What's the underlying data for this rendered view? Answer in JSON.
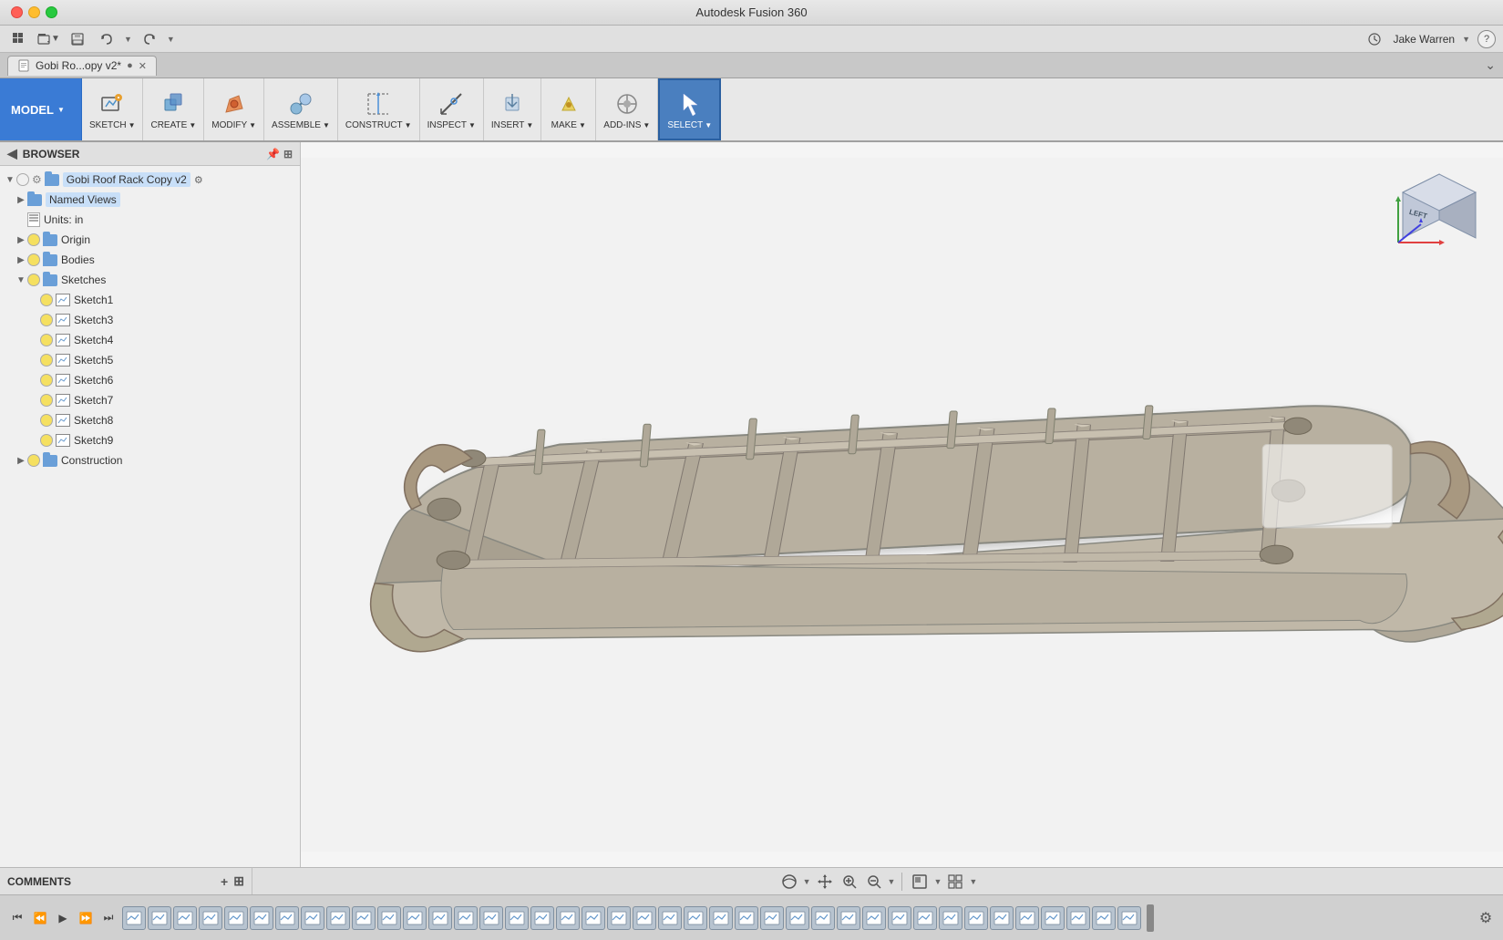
{
  "app": {
    "title": "Autodesk Fusion 360"
  },
  "titlebar": {
    "title": "Autodesk Fusion 360"
  },
  "tab": {
    "label": "Gobi Ro...opy v2*",
    "modified": true
  },
  "ribbon": {
    "model_label": "MODEL",
    "groups": [
      {
        "id": "sketch",
        "label": "SKETCH",
        "has_dropdown": true
      },
      {
        "id": "create",
        "label": "CREATE",
        "has_dropdown": true
      },
      {
        "id": "modify",
        "label": "MODIFY",
        "has_dropdown": true
      },
      {
        "id": "assemble",
        "label": "ASSEMBLE",
        "has_dropdown": true
      },
      {
        "id": "construct",
        "label": "CONSTRUCT",
        "has_dropdown": true
      },
      {
        "id": "inspect",
        "label": "INSPECT",
        "has_dropdown": true
      },
      {
        "id": "insert",
        "label": "INSERT",
        "has_dropdown": true
      },
      {
        "id": "make",
        "label": "MAKE",
        "has_dropdown": true
      },
      {
        "id": "add_ins",
        "label": "ADD-INS",
        "has_dropdown": true
      },
      {
        "id": "select",
        "label": "SELECT",
        "has_dropdown": true,
        "active": true
      }
    ]
  },
  "browser": {
    "title": "BROWSER",
    "root_label": "Gobi Roof Rack Copy v2",
    "items": [
      {
        "id": "named-views",
        "label": "Named Views",
        "indent": 1,
        "expandable": true,
        "expanded": false
      },
      {
        "id": "units",
        "label": "Units: in",
        "indent": 1,
        "expandable": false
      },
      {
        "id": "origin",
        "label": "Origin",
        "indent": 1,
        "expandable": true,
        "expanded": false
      },
      {
        "id": "bodies",
        "label": "Bodies",
        "indent": 1,
        "expandable": true,
        "expanded": false
      },
      {
        "id": "sketches",
        "label": "Sketches",
        "indent": 1,
        "expandable": true,
        "expanded": true
      },
      {
        "id": "sketch1",
        "label": "Sketch1",
        "indent": 2,
        "expandable": false
      },
      {
        "id": "sketch3",
        "label": "Sketch3",
        "indent": 2,
        "expandable": false
      },
      {
        "id": "sketch4",
        "label": "Sketch4",
        "indent": 2,
        "expandable": false
      },
      {
        "id": "sketch5",
        "label": "Sketch5",
        "indent": 2,
        "expandable": false
      },
      {
        "id": "sketch6",
        "label": "Sketch6",
        "indent": 2,
        "expandable": false
      },
      {
        "id": "sketch7",
        "label": "Sketch7",
        "indent": 2,
        "expandable": false
      },
      {
        "id": "sketch8",
        "label": "Sketch8",
        "indent": 2,
        "expandable": false
      },
      {
        "id": "sketch9",
        "label": "Sketch9",
        "indent": 2,
        "expandable": false
      },
      {
        "id": "construction",
        "label": "Construction",
        "indent": 1,
        "expandable": true,
        "expanded": false
      }
    ]
  },
  "comments": {
    "label": "COMMENTS"
  },
  "viewport": {
    "background_color": "#f0f0f0"
  },
  "navcube": {
    "label": "LEFT"
  },
  "statusbar": {
    "view_controls": [
      "orbit",
      "pan",
      "zoom-in",
      "zoom-out",
      "zoom-fit",
      "display-settings",
      "display-mode",
      "grid",
      "more"
    ]
  },
  "timeline": {
    "items_count": 40,
    "settings_label": "⚙"
  },
  "toolbar": {
    "user": "Jake Warren",
    "history_label": "History",
    "save_label": "Save"
  }
}
